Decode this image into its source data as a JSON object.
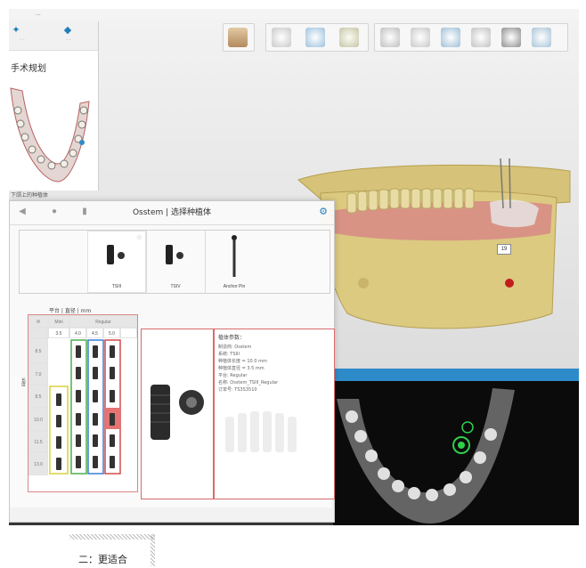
{
  "app": {
    "title": "..."
  },
  "left_panel": {
    "heading": "手术规划",
    "caption": "下颌上的种植体",
    "tabs": [
      {
        "icon": "gear-icon"
      },
      {
        "icon": "tooth-icon"
      }
    ]
  },
  "toolbar": {
    "tools": [
      {
        "icon": "person-icon"
      },
      {
        "icon": "jaw-view-icon"
      },
      {
        "icon": "jaw-rotate-icon"
      },
      {
        "icon": "crown-icon"
      },
      {
        "icon": "tooth-slice-icon"
      },
      {
        "icon": "arch-icon"
      },
      {
        "icon": "implant-tooth-icon"
      },
      {
        "icon": "guide-icon"
      },
      {
        "icon": "implant-icon"
      },
      {
        "icon": "sleeve-icon"
      }
    ]
  },
  "viewport": {
    "tooth_label": "19"
  },
  "dialog": {
    "title": "Osstem | 选择种植体",
    "implants": [
      {
        "name": "TSIII",
        "selected": true
      },
      {
        "name": "TSIV",
        "selected": false
      },
      {
        "name": "Anchor Pin",
        "selected": false
      }
    ],
    "unit_row": "平台 | 直径 | mm",
    "size_table": {
      "col_headers": [
        "Φ",
        "Mini",
        "Regular",
        "",
        "",
        ""
      ],
      "sub_headers": [
        "",
        "3.5",
        "4.0",
        "4.5",
        "5.0"
      ],
      "row_labels": [
        "8.5",
        "7.0",
        "8.5",
        "10.0",
        "11.5",
        "13.0"
      ],
      "side_label": "长度"
    },
    "details": {
      "heading": "植体参数：",
      "lines": [
        "制造商: Osstem",
        "系统: TSIII",
        "种植体长度 = 10.0 mm",
        "种植体直径 = 3.5 mm",
        "平台: Regular",
        "名称: Osstem_TSIII_Regular",
        "订单号: TS3S3510"
      ]
    }
  },
  "footer": {
    "caption": "二：更适合"
  },
  "colors": {
    "accent": "#2e8bc9",
    "selection_border": "#d96b6b",
    "gum": "#c96b6b",
    "bone": "#d9c46e"
  }
}
